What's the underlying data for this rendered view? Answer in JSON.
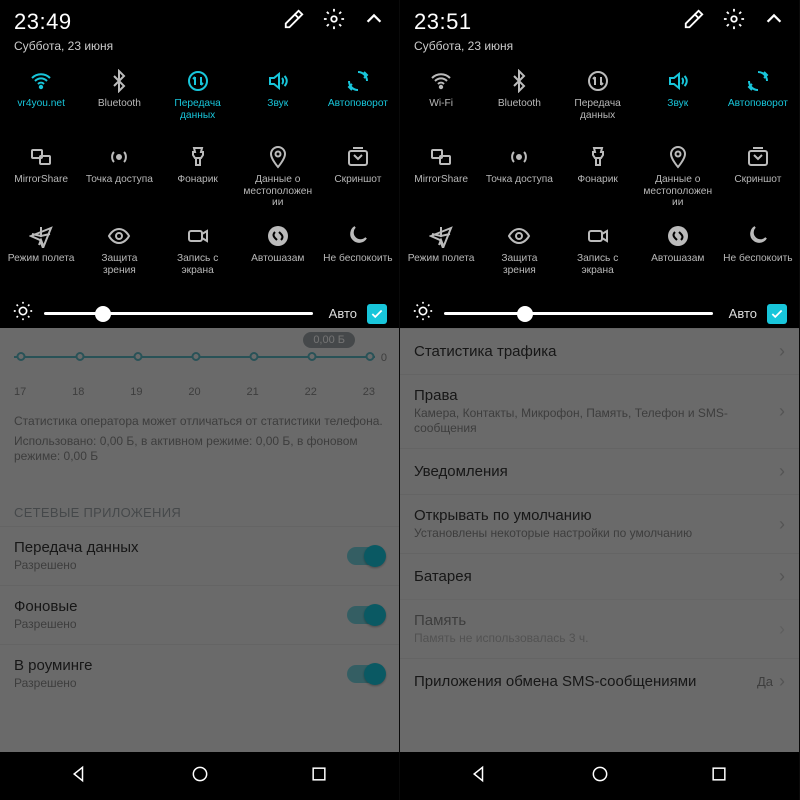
{
  "accent": "#18c6db",
  "panes": [
    {
      "time": "23:49",
      "date": "Суббота, 23 июня",
      "tiles": [
        {
          "icon": "wifi",
          "label": "vr4you.net",
          "active": true
        },
        {
          "icon": "bluetooth",
          "label": "Bluetooth",
          "active": false
        },
        {
          "icon": "data",
          "label": "Передача данных",
          "active": true
        },
        {
          "icon": "volume",
          "label": "Звук",
          "active": true
        },
        {
          "icon": "rotate",
          "label": "Автоповорот",
          "active": true
        },
        {
          "icon": "mirror",
          "label": "MirrorShare",
          "active": false
        },
        {
          "icon": "hotspot",
          "label": "Точка доступа",
          "active": false
        },
        {
          "icon": "flash",
          "label": "Фонарик",
          "active": false
        },
        {
          "icon": "location",
          "label": "Данные о местоположении",
          "active": false
        },
        {
          "icon": "screenshot",
          "label": "Скриншот",
          "active": false
        },
        {
          "icon": "airplane",
          "label": "Режим полета",
          "active": false
        },
        {
          "icon": "eye",
          "label": "Защита зрения",
          "active": false
        },
        {
          "icon": "record",
          "label": "Запись с экрана",
          "active": false
        },
        {
          "icon": "shazam",
          "label": "Автошазам",
          "active": false
        },
        {
          "icon": "moon",
          "label": "Не беспокоить",
          "active": false
        }
      ],
      "brightness": {
        "pct": 22,
        "auto_label": "Авто",
        "auto_checked": true
      },
      "usage": {
        "badge": "0,00 Б",
        "axis": [
          "17",
          "18",
          "19",
          "20",
          "21",
          "22",
          "23"
        ],
        "note1": "Статистика оператора может отличаться от статистики телефона.",
        "note2": "Использовано: 0,00 Б, в активном режиме: 0,00 Б, в фоновом режиме: 0,00 Б"
      },
      "section_header": "СЕТЕВЫЕ ПРИЛОЖЕНИЯ",
      "rows": [
        {
          "title": "Передача данных",
          "sub": "Разрешено",
          "toggle": true
        },
        {
          "title": "Фоновые",
          "sub": "Разрешено",
          "toggle": true
        },
        {
          "title": "В роуминге",
          "sub": "Разрешено",
          "toggle": true
        }
      ]
    },
    {
      "time": "23:51",
      "date": "Суббота, 23 июня",
      "tiles": [
        {
          "icon": "wifi",
          "label": "Wi-Fi",
          "active": false
        },
        {
          "icon": "bluetooth",
          "label": "Bluetooth",
          "active": false
        },
        {
          "icon": "data",
          "label": "Передача данных",
          "active": false
        },
        {
          "icon": "volume",
          "label": "Звук",
          "active": true
        },
        {
          "icon": "rotate",
          "label": "Автоповорот",
          "active": true
        },
        {
          "icon": "mirror",
          "label": "MirrorShare",
          "active": false
        },
        {
          "icon": "hotspot",
          "label": "Точка доступа",
          "active": false
        },
        {
          "icon": "flash",
          "label": "Фонарик",
          "active": false
        },
        {
          "icon": "location",
          "label": "Данные о местоположении",
          "active": false
        },
        {
          "icon": "screenshot",
          "label": "Скриншот",
          "active": false
        },
        {
          "icon": "airplane",
          "label": "Режим полета",
          "active": false
        },
        {
          "icon": "eye",
          "label": "Защита зрения",
          "active": false
        },
        {
          "icon": "record",
          "label": "Запись с экрана",
          "active": false
        },
        {
          "icon": "shazam",
          "label": "Автошазам",
          "active": false
        },
        {
          "icon": "moon",
          "label": "Не беспокоить",
          "active": false
        }
      ],
      "brightness": {
        "pct": 30,
        "auto_label": "Авто",
        "auto_checked": true
      },
      "settings": [
        {
          "title": "Статистика трафика",
          "sub": "",
          "extra": ""
        },
        {
          "title": "Права",
          "sub": "Камера, Контакты, Микрофон, Память, Телефон и SMS-сообщения",
          "extra": ""
        },
        {
          "title": "Уведомления",
          "sub": "",
          "extra": ""
        },
        {
          "title": "Открывать по умолчанию",
          "sub": "Установлены некоторые настройки по умолчанию",
          "extra": ""
        },
        {
          "title": "Батарея",
          "sub": "",
          "extra": ""
        },
        {
          "title": "Память",
          "sub": "Память не использовалась 3 ч.",
          "extra": "",
          "faded": true
        },
        {
          "title": "Приложения обмена SMS-сообщениями",
          "sub": "",
          "extra": "Да"
        }
      ]
    }
  ]
}
